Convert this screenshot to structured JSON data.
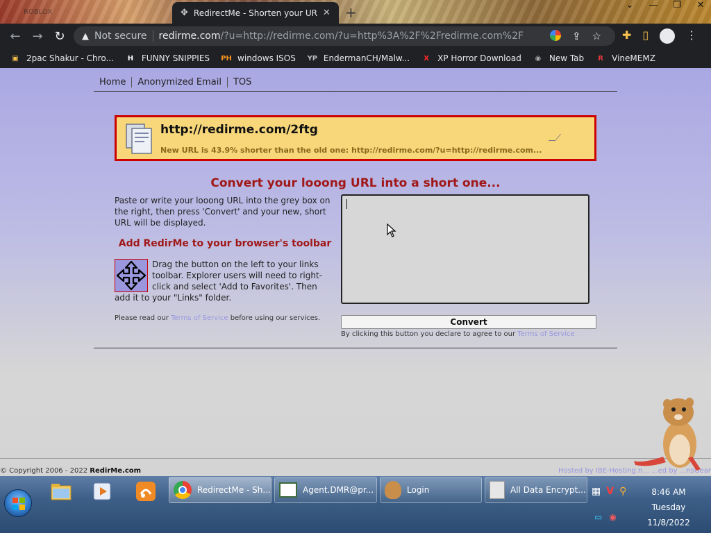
{
  "browser": {
    "inactive_tab_label": "ROBLOX",
    "active_tab_title": "RedirectMe - Shorten your URL f",
    "tab_close_glyph": "✕",
    "new_tab_glyph": "+",
    "window_controls": [
      "⌄",
      "—",
      "❐",
      "✕"
    ],
    "nav": {
      "back": "←",
      "forward": "→",
      "reload": "↻"
    },
    "omnibox": {
      "warning_glyph": "▲",
      "security_label": "Not secure",
      "host": "redirme.com",
      "path": "/?u=http://redirme.com/?u=http%3A%2F%2Fredirme.com%2F"
    },
    "bookmarks": [
      {
        "icon": "pc-icon",
        "glyph": "▣",
        "color": "#f6c04d",
        "label": "2pac Shakur - Chro..."
      },
      {
        "icon": "h-icon",
        "glyph": "H",
        "color": "#ffffff",
        "label": "FUNNY SNIPPIES"
      },
      {
        "icon": "ph-icon",
        "glyph": "PH",
        "color": "#f7941d",
        "label": "windows ISOS"
      },
      {
        "icon": "yp-icon",
        "glyph": "YP",
        "color": "#bbbbbb",
        "label": "EndermanCH/Malw..."
      },
      {
        "icon": "x-icon",
        "glyph": "X",
        "color": "#ff2a2a",
        "label": "XP Horror Download"
      },
      {
        "icon": "globe-icon",
        "glyph": "◉",
        "color": "#aaaaaa",
        "label": "New Tab"
      },
      {
        "icon": "r-icon",
        "glyph": "R",
        "color": "#e23a3a",
        "label": "VineMEMZ"
      }
    ]
  },
  "page": {
    "nav": [
      "Home",
      "Anonymized Email",
      "TOS"
    ],
    "result": {
      "short_url": "http://redirme.com/2ftg",
      "savings_text": "New URL is 43.9% shorter than the old one: http://redirme.com/?u=http://redirme.com..."
    },
    "heading": "Convert your looong URL into a short one...",
    "instructions": "Paste or write your looong URL into the grey box on the right, then press 'Convert' and your new, short URL will be displayed.",
    "toolbar_heading": "Add RedirMe to your browser's toolbar",
    "drag_text": "Drag the button on the left to your links toolbar. Explorer users will need to right-click and select 'Add to Favorites'. Then add it to your \"Links\" folder.",
    "read_prefix": "Please read our",
    "tos_link": "Terms of Service",
    "read_suffix": "before using our services.",
    "url_input_value": "",
    "convert_label": "Convert",
    "agree_prefix": "By clicking this button you declare to agree to our",
    "agree_link": "Terms of Service",
    "footer_copy_prefix": "© Copyright 2006 - 2022",
    "footer_copy_site": "RedirMe.com",
    "footer_hosted": "Hosted by IBE-Hosting.n... ...ed by ...nsGear"
  },
  "taskbar": {
    "items": [
      {
        "name": "chrome",
        "label": "RedirectMe - Sh...",
        "active": true
      },
      {
        "name": "agent",
        "label": "Agent.DMR@pr...",
        "active": false
      },
      {
        "name": "login",
        "label": "Login",
        "active": false
      },
      {
        "name": "encrypt",
        "label": "All Data Encrypt...",
        "active": false
      }
    ],
    "clock": {
      "time": "8:46 AM",
      "day": "Tuesday",
      "date": "11/8/2022"
    }
  },
  "colors": {
    "accent_red": "#a01818",
    "result_bg": "#f7d77a",
    "result_border": "#cc0000",
    "link_lavender": "#9a97df",
    "page_top": "#aaa8e3"
  }
}
